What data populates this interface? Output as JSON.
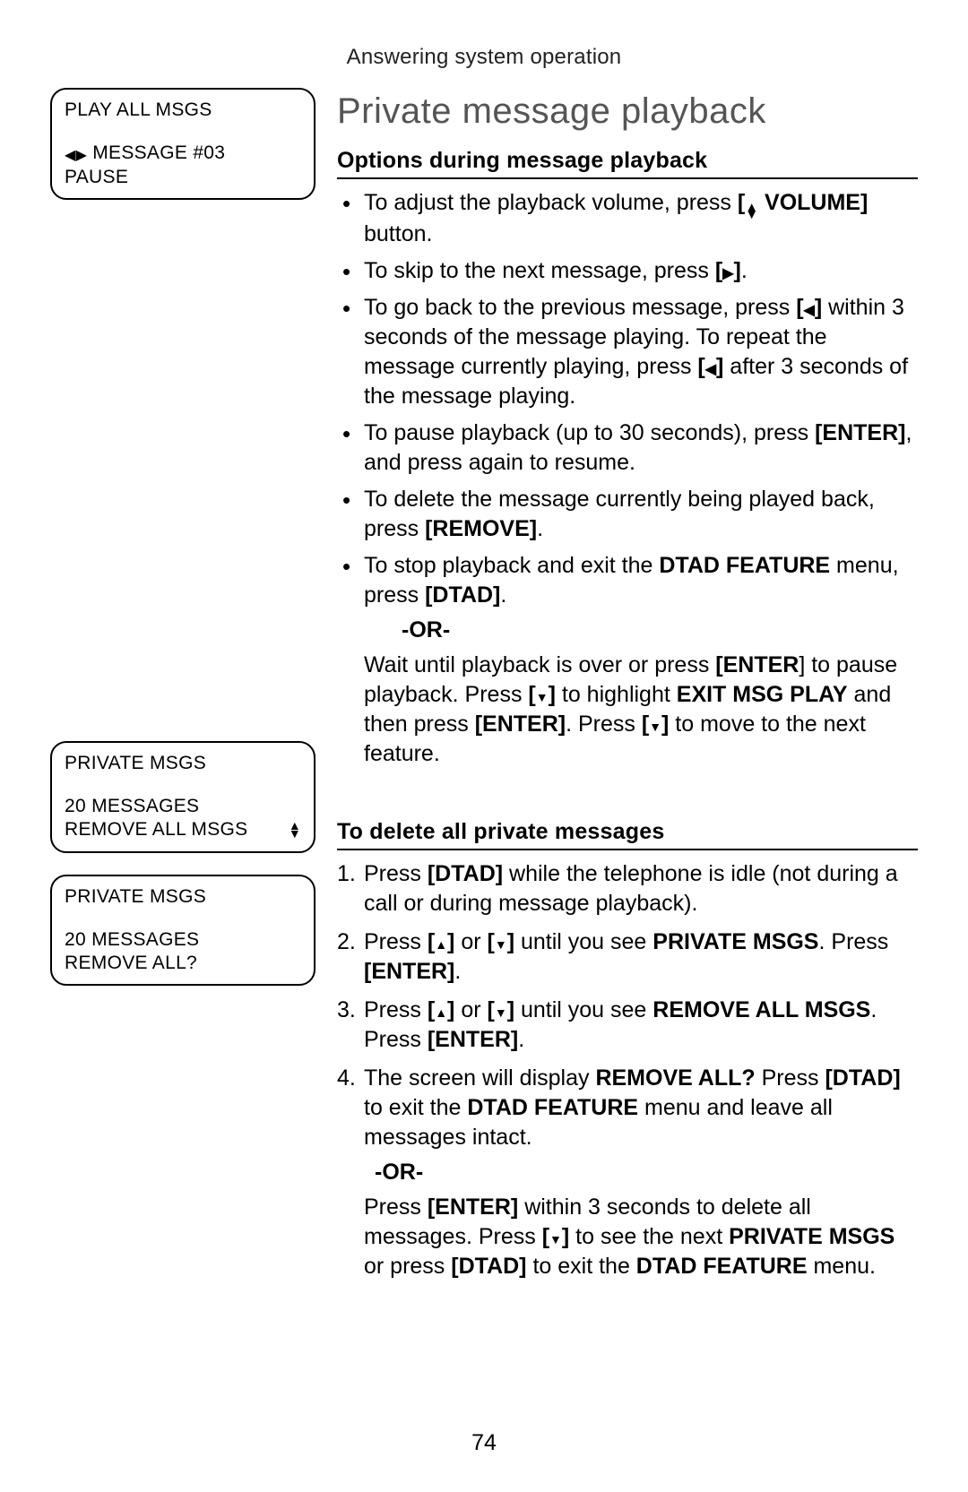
{
  "running_head": "Answering system operation",
  "page_title": "Private message playback",
  "page_number": "74",
  "sections": {
    "options": {
      "heading": "Options during message playback",
      "b1_a": "To adjust the playback volume, press ",
      "b1_vol": " VOLUME]",
      "b1_b": " button.",
      "b2_a": "To skip to the next message, press ",
      "b2_b": ".",
      "b3_a": "To go back to the previous message, press ",
      "b3_b": " within 3 seconds of the message playing. To repeat the message currently playing, press  ",
      "b3_c": " after 3 seconds of the message playing.",
      "b4_a": "To pause playback (up to 30 seconds), press ",
      "b4_enter": "[ENTER]",
      "b4_b": ", and press again to resume.",
      "b5_a": "To delete the message currently being played back, press ",
      "b5_remove": "[REMOVE]",
      "b5_b": ".",
      "b6_a": "To stop playback and exit the ",
      "b6_feat": "DTAD FEATURE",
      "b6_b": " menu, press ",
      "b6_dtad": "[DTAD]",
      "b6_c": ".",
      "or": "-OR-",
      "b6_sub_a": "Wait until playback is over or press ",
      "b6_sub_enter": "[ENTER",
      "b6_sub_b": "] to pause playback. Press ",
      "b6_sub_c": " to highlight ",
      "b6_sub_exit": "EXIT MSG PLAY",
      "b6_sub_d": " and then press ",
      "b6_sub_enter2": "[ENTER]",
      "b6_sub_e": ". Press ",
      "b6_sub_f": " to move to the next feature."
    },
    "delete": {
      "heading": "To delete all private messages",
      "s1_a": "Press ",
      "s1_dtad": "[DTAD]",
      "s1_b": " while the telephone is idle (not during a call or during message playback).",
      "s2_a": "Press ",
      "s2_or": " or ",
      "s2_b": " until you see ",
      "s2_priv": "PRIVATE MSGS",
      "s2_c": ". Press ",
      "s2_enter": "[ENTER]",
      "s2_d": ".",
      "s3_a": "Press ",
      "s3_or": " or ",
      "s3_b": " until you see ",
      "s3_rem": "REMOVE ALL MSGS",
      "s3_c": ". Press ",
      "s3_enter": "[ENTER]",
      "s3_d": ".",
      "s4_a": "The screen will display ",
      "s4_q": "REMOVE ALL?",
      "s4_b": " Press ",
      "s4_dtad": "[DTAD]",
      "s4_c": " to exit the ",
      "s4_feat": "DTAD FEATURE",
      "s4_d": " menu and leave all messages intact.",
      "or": "-OR-",
      "s4_sub_a": "Press ",
      "s4_sub_enter": "[ENTER]",
      "s4_sub_b": " within 3 seconds to delete all messages. Press ",
      "s4_sub_c": " to see the next ",
      "s4_sub_priv": "PRIVATE MSGS",
      "s4_sub_d": " or press ",
      "s4_sub_dtad": "[DTAD]",
      "s4_sub_e": " to exit the ",
      "s4_sub_feat": "DTAD FEATURE",
      "s4_sub_f": " menu."
    }
  },
  "lcd": {
    "play": {
      "l1": "PLAY ALL MSGS",
      "l2": "MESSAGE #03",
      "l3": "PAUSE"
    },
    "priv1": {
      "l1": "PRIVATE MSGS",
      "l2": "20 MESSAGES",
      "l3": "REMOVE ALL MSGS"
    },
    "priv2": {
      "l1": "PRIVATE MSGS",
      "l2": "20 MESSAGES",
      "l3": "REMOVE ALL?"
    }
  },
  "glyphs": {
    "left_bracket": "[",
    "right_bracket": "]"
  }
}
